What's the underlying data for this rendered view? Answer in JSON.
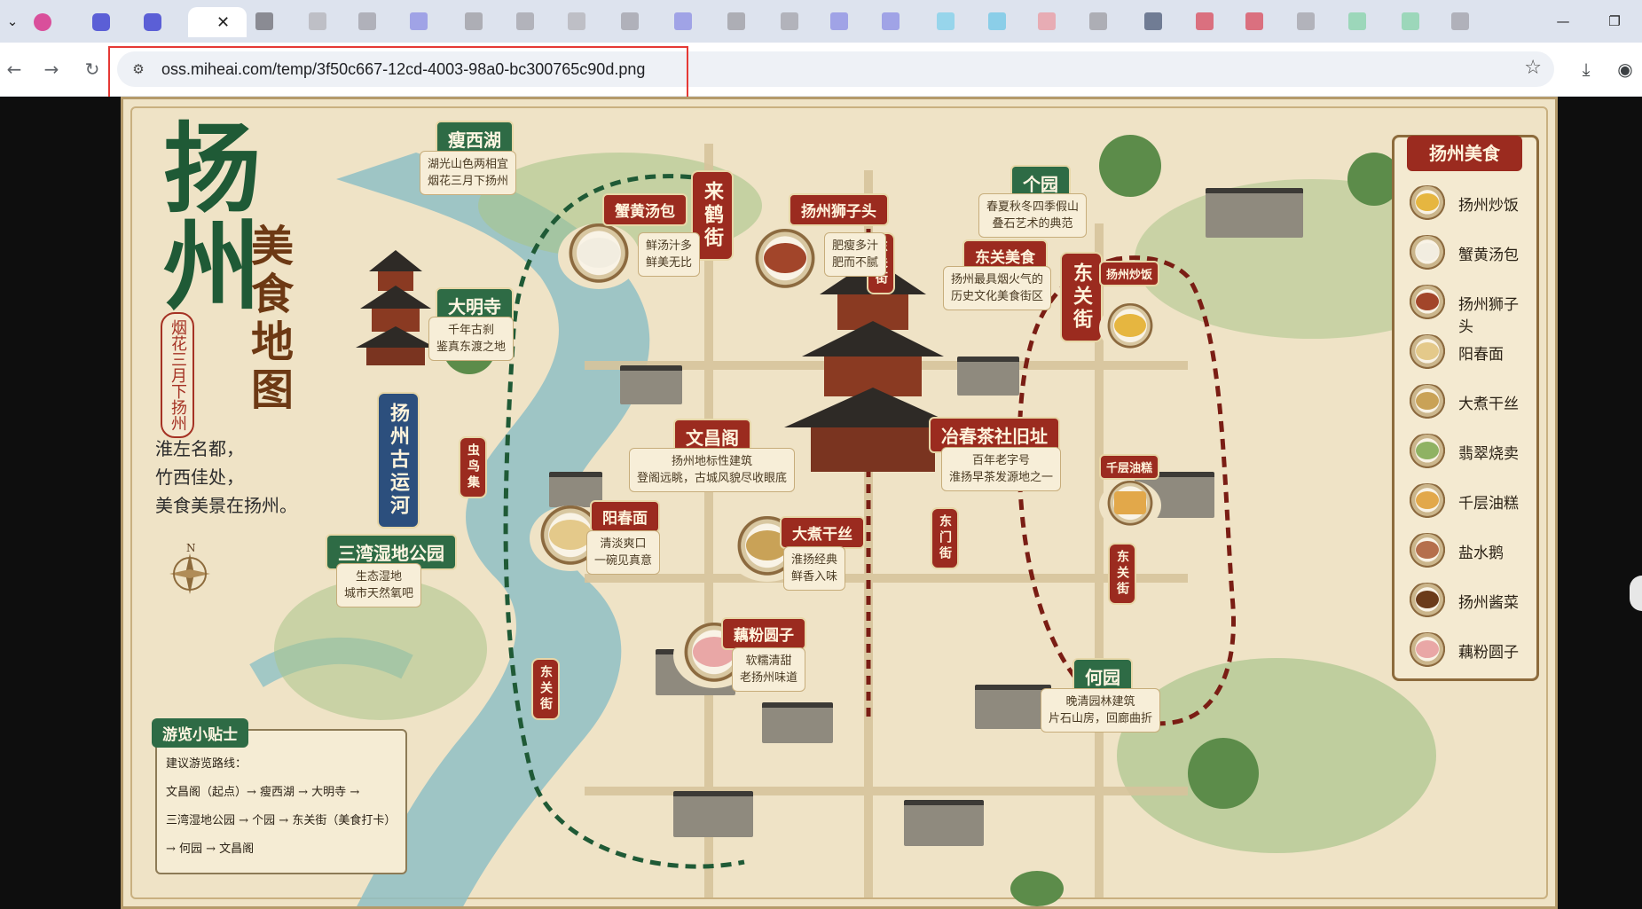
{
  "browser": {
    "tabs": [
      {
        "title": "",
        "active": false
      },
      {
        "title": "",
        "active": false
      },
      {
        "title": "",
        "active": false
      },
      {
        "title": "",
        "active": true,
        "close_glyph": "✕"
      }
    ],
    "window_controls": {
      "minimize": "—",
      "restore": "❐"
    },
    "nav": {
      "back": "←",
      "forward": "→",
      "reload": "↻"
    },
    "address_bar": {
      "url": "oss.miheai.com/temp/3f50c667-12cd-4003-98a0-bc300765c90d.png",
      "site_icon": "tune-icon",
      "bookmark": "☆"
    },
    "toolbar_right": {
      "download": "⤓",
      "profile": "◉"
    }
  },
  "map": {
    "title_main": "扬州",
    "title_side": "美食地图",
    "seal": "烟花三月下扬州",
    "poem": [
      "淮左名都，",
      "竹西佳处，",
      "美食美景在扬州。"
    ],
    "places": {
      "slender_west_lake": {
        "name": "瘦西湖",
        "note": [
          "湖光山色两相宜",
          "烟花三月下扬州"
        ]
      },
      "daming_temple": {
        "name": "大明寺",
        "note": [
          "千年古刹",
          "鉴真东渡之地"
        ]
      },
      "grand_canal": {
        "name": "扬州古运河"
      },
      "sanwan": {
        "name": "三湾湿地公园",
        "note": [
          "生态湿地",
          "城市天然氧吧"
        ]
      },
      "wenchang": {
        "name": "文昌阁",
        "note": [
          "扬州地标性建筑",
          "登阁远眺，古城风貌尽收眼底"
        ]
      },
      "ge_garden": {
        "name": "个园",
        "note": [
          "春夏秋冬四季假山",
          "叠石艺术的典范"
        ]
      },
      "dongguan": {
        "name": "东关美食",
        "note": [
          "扬州最具烟火气的",
          "历史文化美食街区"
        ]
      },
      "dongguan_street": {
        "name": "东关街"
      },
      "yechun": {
        "name": "冶春茶社旧址",
        "note": [
          "百年老字号",
          "淮扬早茶发源地之一"
        ]
      },
      "he_garden": {
        "name": "何园",
        "note": [
          "晚清园林建筑",
          "片石山房，回廊曲折"
        ]
      },
      "dongmen": {
        "name": "东门街"
      }
    },
    "dishes_on_map": {
      "crab_bun": {
        "name": "蟹黄汤包",
        "note": [
          "鲜汤汁多",
          "鲜美无比"
        ]
      },
      "lion_head": {
        "name": "扬州狮子头",
        "note": [
          "肥瘦多汁",
          "肥而不腻"
        ]
      },
      "yangchun": {
        "name": "阳春面",
        "note": [
          "清淡爽口",
          "一碗见真意"
        ]
      },
      "dazhu": {
        "name": "大煮干丝",
        "note": [
          "淮扬经典",
          "鲜香入味"
        ]
      },
      "lotus_ball": {
        "name": "藕粉圆子",
        "note": [
          "软糯清甜",
          "老扬州味道"
        ]
      },
      "fried_rice_side": {
        "name": "扬州炒饭"
      },
      "qianceng_side": {
        "name": "千层油糕"
      }
    },
    "legend": {
      "title": "扬州美食",
      "items": [
        "扬州炒饭",
        "蟹黄汤包",
        "扬州狮子头",
        "阳春面",
        "大煮干丝",
        "翡翠烧卖",
        "千层油糕",
        "盐水鹅",
        "扬州酱菜",
        "藕粉圆子"
      ],
      "food_colors": [
        "#e6b640",
        "#f2ede0",
        "#a2452a",
        "#e4c98a",
        "#c9a257",
        "#8fb263",
        "#e2a84a",
        "#b56f4c",
        "#6b3b1a",
        "#e9a7a6"
      ]
    },
    "tips": {
      "title": "游览小贴士",
      "lines": [
        "建议游览路线：",
        "文昌阁（起点）→ 瘦西湖 → 大明寺 →",
        "三湾湿地公园 → 个园 → 东关街（美食打卡）",
        "→ 何园 → 文昌阁"
      ]
    },
    "compass_letter": "N",
    "vertical_labels": {
      "laifeng": "来鹤街",
      "right_small_1": "东关街",
      "left_small": "虫鸟集",
      "bottom_small": "东关街",
      "right_small_2": "东关街"
    },
    "colors": {
      "accent_red": "#9b2b1f",
      "accent_green": "#2e6b45",
      "parchment": "#efe3c6"
    }
  }
}
